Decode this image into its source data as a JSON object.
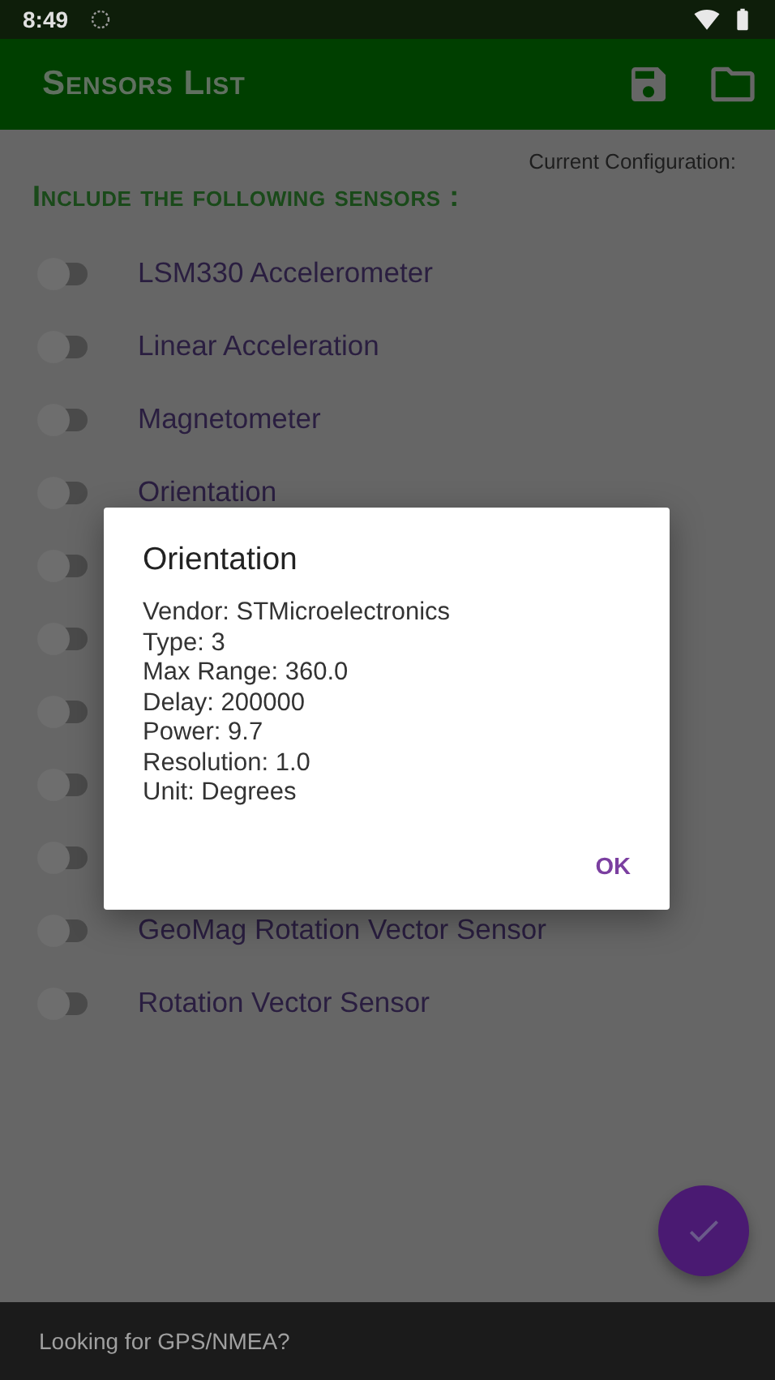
{
  "status_bar": {
    "time": "8:49"
  },
  "app_bar": {
    "title": "Sensors List"
  },
  "current_configuration": "Current Configuration:",
  "heading": "Include the following sensors :",
  "sensors": [
    {
      "name": "LSM330 Accelerometer",
      "on": false
    },
    {
      "name": "Linear Acceleration",
      "on": false
    },
    {
      "name": "Magnetometer",
      "on": false
    },
    {
      "name": "Orientation",
      "on": false
    },
    {
      "on": false
    },
    {
      "on": false
    },
    {
      "on": false
    },
    {
      "on": false
    },
    {
      "on": false
    },
    {
      "name": "GeoMag Rotation Vector Sensor",
      "on": false
    },
    {
      "name": "Rotation Vector Sensor",
      "on": false
    }
  ],
  "dialog": {
    "title": "Orientation",
    "lines": [
      "Vendor: STMicroelectronics",
      "Type: 3",
      "Max Range: 360.0",
      "Delay: 200000",
      "Power: 9.7",
      "Resolution: 1.0",
      "Unit: Degrees"
    ],
    "button": "OK"
  },
  "snackbar": {
    "message": "Looking for GPS/NMEA?"
  }
}
